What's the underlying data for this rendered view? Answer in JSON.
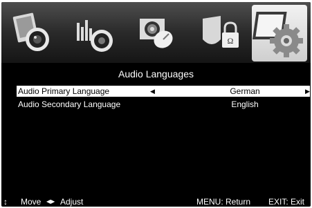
{
  "icon_bar": {
    "tabs": [
      {
        "name": "picture-icon"
      },
      {
        "name": "sound-icon"
      },
      {
        "name": "channel-icon"
      },
      {
        "name": "lock-icon"
      },
      {
        "name": "setup-gear-icon",
        "selected": true
      }
    ]
  },
  "menu": {
    "title": "Audio Languages",
    "items": [
      {
        "label": "Audio Primary Language",
        "value": "German",
        "selected": true
      },
      {
        "label": "Audio Secondary Language",
        "value": "English",
        "selected": false
      }
    ]
  },
  "footer": {
    "move": "Move",
    "adjust": "Adjust",
    "menu": "MENU: Return",
    "exit": "EXIT: Exit"
  },
  "colors": {
    "background": "#000000",
    "highlight": "#ffffff",
    "text": "#ffffff"
  }
}
